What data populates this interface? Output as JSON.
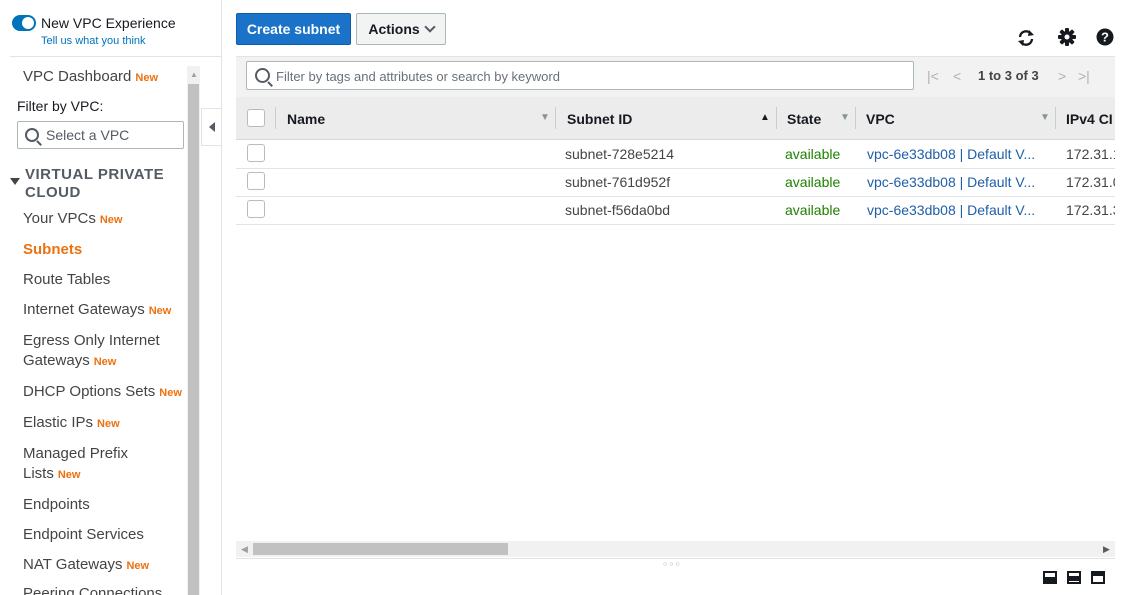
{
  "sidebar": {
    "experience_toggle_label": "New VPC Experience",
    "feedback_link": "Tell us what you think",
    "vpc_dashboard": "VPC Dashboard",
    "new_badge": "New",
    "filter_label": "Filter by VPC:",
    "vpc_select_placeholder": "Select a VPC",
    "section_title": "VIRTUAL PRIVATE CLOUD",
    "items": [
      {
        "label": "Your VPCs",
        "new": "New"
      },
      {
        "label": "Subnets"
      },
      {
        "label": "Route Tables"
      },
      {
        "label": "Internet Gateways",
        "new": "New"
      },
      {
        "label_line1": "Egress Only Internet",
        "label_line2": "Gateways",
        "new": "New"
      },
      {
        "label": "DHCP Options Sets",
        "new": "New"
      },
      {
        "label": "Elastic IPs",
        "new": "New"
      },
      {
        "label_line1": "Managed Prefix",
        "label_line2": "Lists",
        "new": "New"
      },
      {
        "label": "Endpoints"
      },
      {
        "label": "Endpoint Services"
      },
      {
        "label": "NAT Gateways",
        "new": "New"
      },
      {
        "label": "Peering Connections"
      }
    ]
  },
  "toolbar": {
    "create_label": "Create subnet",
    "actions_label": "Actions"
  },
  "filter": {
    "placeholder": "Filter by tags and attributes or search by keyword"
  },
  "pagination": {
    "text": "1 to 3 of 3"
  },
  "table": {
    "columns": [
      "Name",
      "Subnet ID",
      "State",
      "VPC",
      "IPv4 CI"
    ],
    "rows": [
      {
        "name": "",
        "subnet_id": "subnet-728e5214",
        "state": "available",
        "vpc": "vpc-6e33db08 | Default V...",
        "cidr": "172.31.1"
      },
      {
        "name": "",
        "subnet_id": "subnet-761d952f",
        "state": "available",
        "vpc": "vpc-6e33db08 | Default V...",
        "cidr": "172.31.0"
      },
      {
        "name": "",
        "subnet_id": "subnet-f56da0bd",
        "state": "available",
        "vpc": "vpc-6e33db08 | Default V...",
        "cidr": "172.31.3"
      }
    ]
  },
  "icons": [
    "refresh-icon",
    "gear-icon",
    "help-icon"
  ],
  "colors": {
    "primary": "#1a73c8",
    "accent": "#ec7211",
    "available": "#1d8102",
    "link": "#1f5fa7"
  }
}
